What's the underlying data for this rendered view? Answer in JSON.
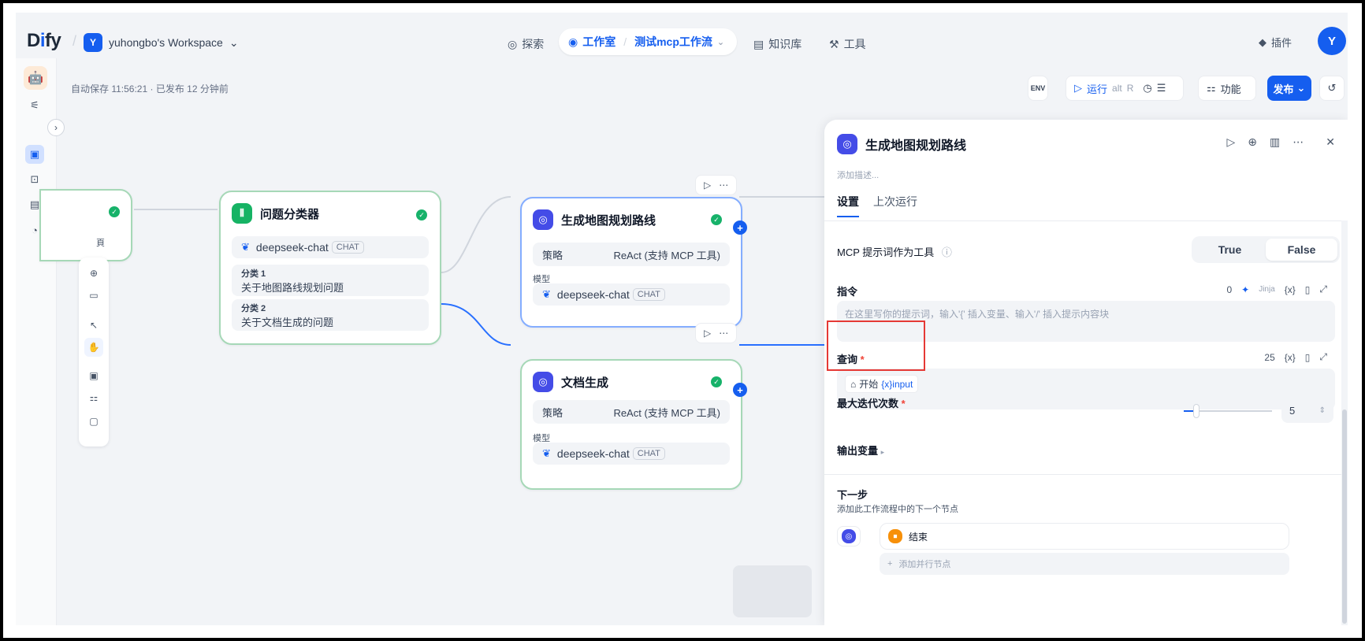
{
  "header": {
    "logo_a": "D",
    "logo_i": "i",
    "logo_b": "fy",
    "workspace_badge": "Y",
    "workspace_name": "yuhongbo's Workspace",
    "nav_explore": "探索",
    "nav_studio": "工作室",
    "nav_app": "测试mcp工作流",
    "nav_knowledge": "知识库",
    "nav_tools": "工具",
    "plugins": "插件",
    "avatar": "Y"
  },
  "status": {
    "autosave": "自动保存 11:56:21 · 已发布 12 分钟前"
  },
  "toolbar": {
    "env": "ENV",
    "run": "运行",
    "run_shortcut_a": "alt",
    "run_shortcut_b": "R",
    "features": "功能",
    "publish": "发布"
  },
  "nodes": {
    "classifier": {
      "title": "问题分类器",
      "model": "deepseek-chat",
      "model_tag": "CHAT",
      "class1_label": "分类 1",
      "class1_text": "关于地图路线规划问题",
      "class2_label": "分类 2",
      "class2_text": "关于文档生成的问题"
    },
    "map_agent": {
      "title": "生成地图规划路线",
      "strategy_label": "策略",
      "strategy_value": "ReAct (支持 MCP 工具)",
      "model_label": "模型",
      "model": "deepseek-chat",
      "model_tag": "CHAT"
    },
    "doc_agent": {
      "title": "文档生成",
      "strategy_label": "策略",
      "strategy_value": "ReAct (支持 MCP 工具)",
      "model_label": "模型",
      "model": "deepseek-chat",
      "model_tag": "CHAT"
    },
    "left_partial_label": "頁"
  },
  "panel": {
    "title": "生成地图规划路线",
    "description_placeholder": "添加描述...",
    "tab_settings": "设置",
    "tab_last_run": "上次运行",
    "mcp_prompt_label": "MCP 提示词作为工具",
    "toggle_true": "True",
    "toggle_false": "False",
    "instruction_label": "指令",
    "instruction_count": "0",
    "instruction_jinja": "Jinja",
    "instruction_placeholder": "在这里写你的提示词，输入'{' 插入变量、输入'/' 插入提示内容块",
    "query_label": "查询",
    "query_count": "25",
    "query_var_node": "开始",
    "query_var_name": "{x}input",
    "max_iter_label": "最大迭代次数",
    "max_iter_value": "5",
    "output_vars_label": "输出变量",
    "next_step_title": "下一步",
    "next_step_desc": "添加此工作流程中的下一个节点",
    "next_node_name": "结束",
    "add_parallel": "添加并行节点"
  },
  "colors": {
    "accent": "#155eef",
    "node_ok_border": "#a6d8b7",
    "highlight_box": "#e53935"
  }
}
